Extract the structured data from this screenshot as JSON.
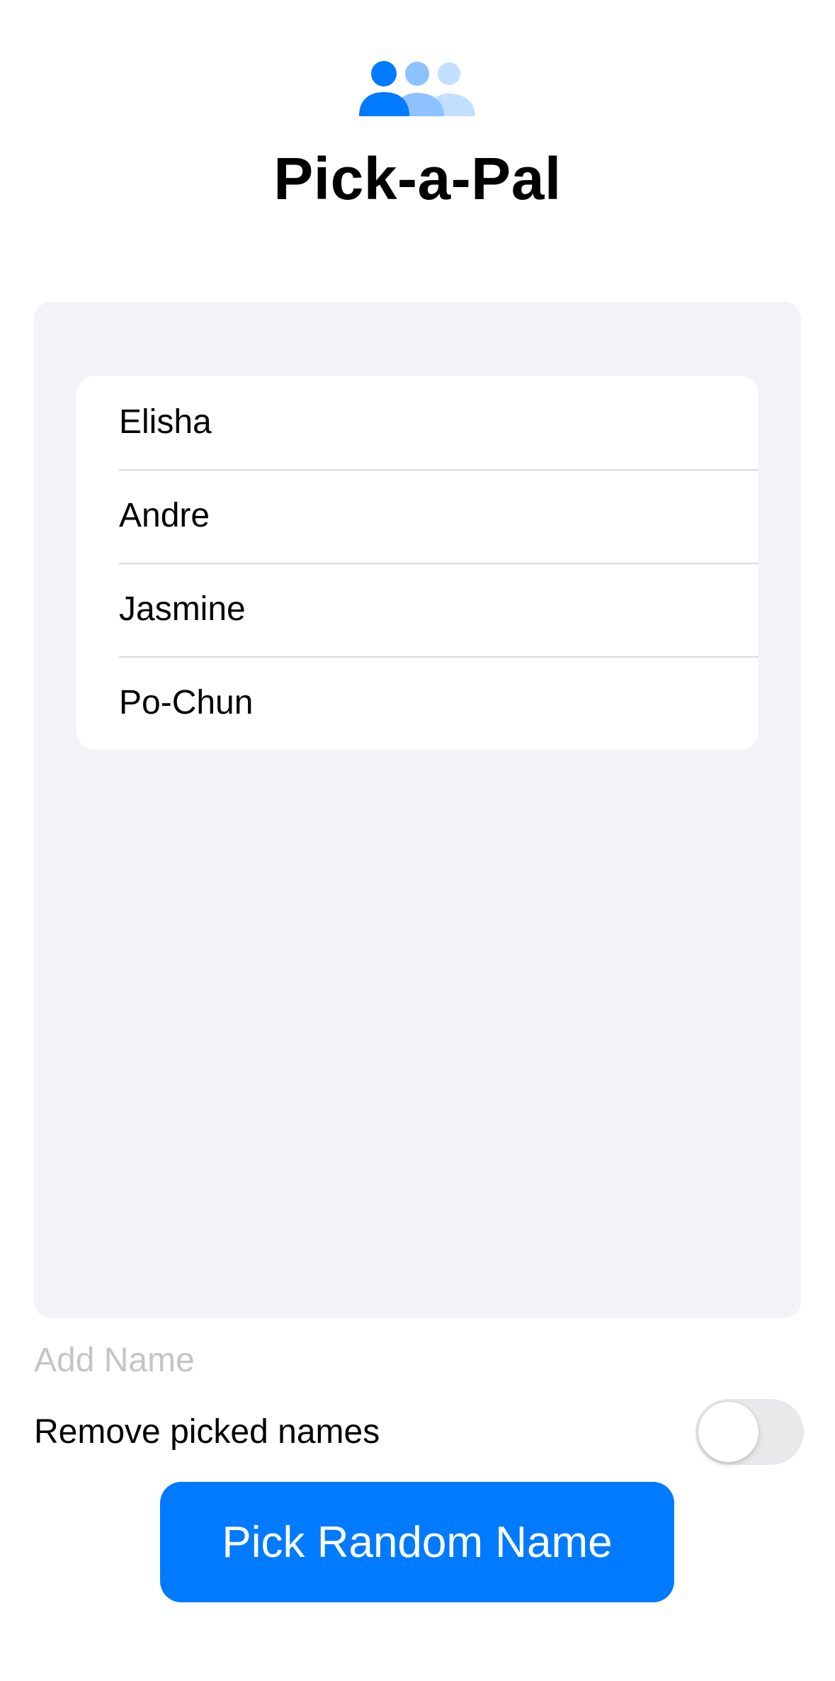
{
  "app": {
    "title": "Pick-a-Pal",
    "icon": "person-3-icon",
    "accent_color": "#007aff"
  },
  "names": [
    {
      "label": "Elisha"
    },
    {
      "label": "Andre"
    },
    {
      "label": "Jasmine"
    },
    {
      "label": "Po-Chun"
    }
  ],
  "add_name": {
    "placeholder": "Add Name",
    "value": ""
  },
  "remove_picked": {
    "label": "Remove picked names",
    "enabled": false
  },
  "pick_button": {
    "label": "Pick Random Name"
  }
}
